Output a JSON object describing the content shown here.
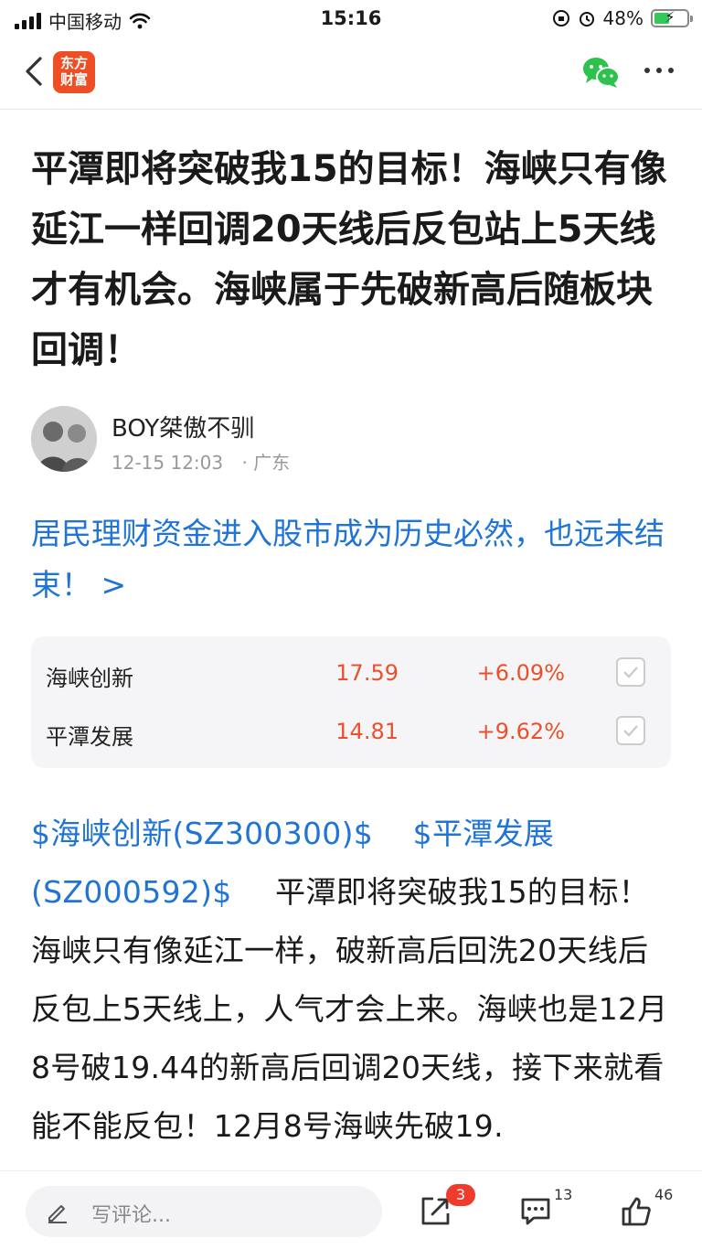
{
  "status_bar": {
    "carrier": "中国移动",
    "time": "15:16",
    "battery_percent": "48%",
    "battery_level": 0.48
  },
  "nav": {
    "logo_line1": "东方",
    "logo_line2": "财富",
    "back_icon": "chevron-left-icon",
    "share_icon": "wechat-icon",
    "more_icon": "more-dots-icon"
  },
  "article": {
    "title": "平潭即将突破我15的目标！海峡只有像延江一样回调20天线后反包站上5天线才有机会。海峡属于先破新高后随板块回调！",
    "author": {
      "name": "BOY桀傲不驯",
      "datetime": "12-15 12:03",
      "location": "· 广东"
    },
    "related_link": "居民理财资金进入股市成为历史必然，也远未结束！ >",
    "stocks": [
      {
        "name": "海峡创新",
        "price": "17.59",
        "change": "+6.09%"
      },
      {
        "name": "平潭发展",
        "price": "14.81",
        "change": "+9.62%"
      }
    ],
    "body_tags": [
      "$海峡创新(SZ300300)$",
      "$平潭发展(SZ000592)$"
    ],
    "body_text": "平潭即将突破我15的目标！海峡只有像延江一样，破新高后回洗20天线后反包上5天线上，人气才会上来。海峡也是12月8号破19.44的新高后回调20天线，接下来就看能不能反包！12月8号海峡先破19."
  },
  "bottom_bar": {
    "comment_placeholder": "写评论...",
    "share_badge": "3",
    "comment_count": "13",
    "like_count": "46"
  },
  "colors": {
    "accent_blue": "#1f74d6",
    "up_red": "#e9512a",
    "brand_orange": "#ef4d24",
    "badge_red": "#ef3b2c"
  }
}
